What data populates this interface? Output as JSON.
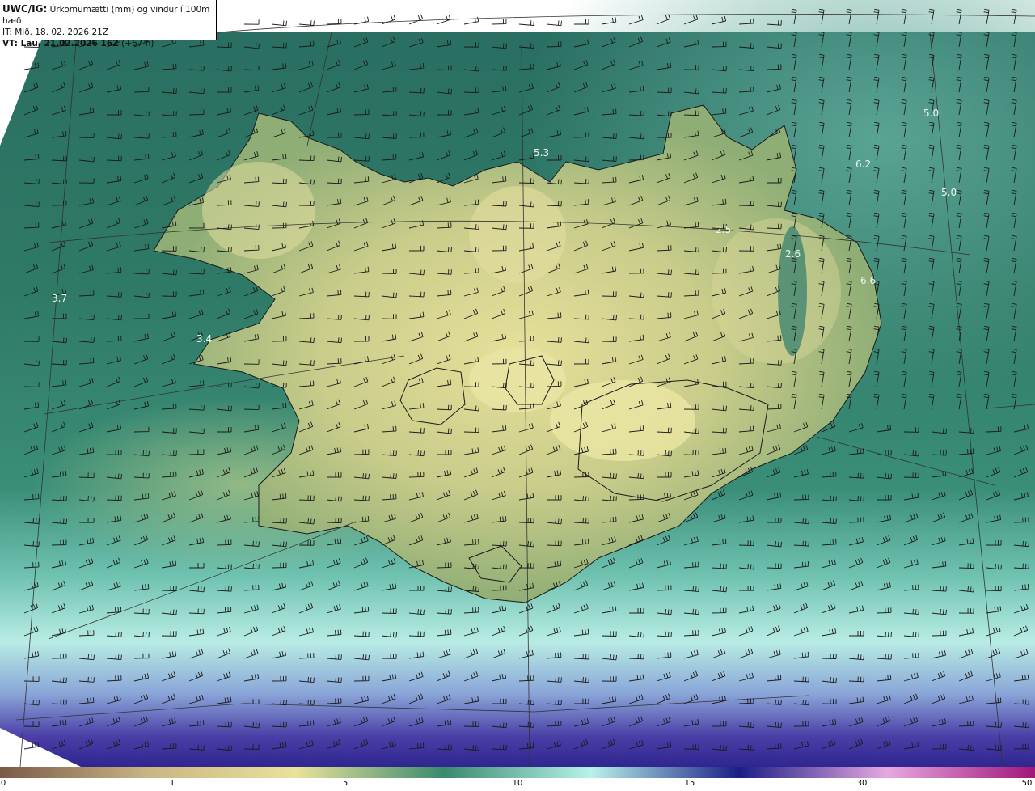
{
  "header": {
    "product_label": "UWC/IG:",
    "product_desc": "Úrkomumætti (mm) og vindur í 100m hæð",
    "it_line": "IT: Mið. 18. 02. 2026 21Z",
    "vt_label": "VT: Lau. 21.02.2026 16Z",
    "vt_offset": "(+67 h)"
  },
  "map_labels": [
    {
      "text": "5.3"
    },
    {
      "text": "5.0"
    },
    {
      "text": "6.2"
    },
    {
      "text": "5.0"
    },
    {
      "text": "2.5"
    },
    {
      "text": "2.6"
    },
    {
      "text": "6.6"
    },
    {
      "text": "3.7"
    },
    {
      "text": "3.4"
    }
  ],
  "legend": {
    "ticks": [
      "0",
      "1",
      "5",
      "10",
      "15",
      "30",
      "50"
    ],
    "colors": [
      "#7a5a48",
      "#c9b584",
      "#e9e29a",
      "#3a8a6e",
      "#b8f2ea",
      "#1a1e86",
      "#e7a8e0",
      "#a0157a"
    ]
  },
  "colors": {
    "water_dark": "#1e6a62",
    "water_mid": "#2f7c6c",
    "land_mid": "#8fae76",
    "land_high": "#e2dd9a",
    "south_light": "#bdebe0",
    "south_deep": "#3a2f9a"
  }
}
